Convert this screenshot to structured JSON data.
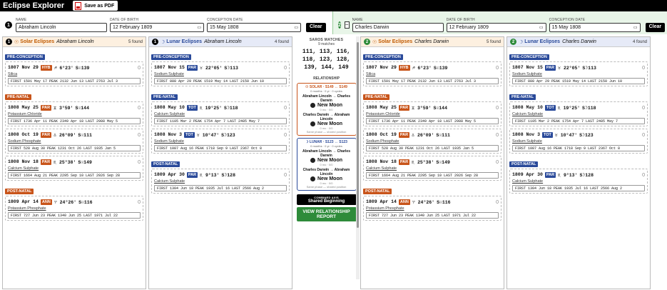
{
  "app": {
    "title": "Eclipse Explorer",
    "save_pdf": "Save as PDF"
  },
  "labels": {
    "name": "NAME",
    "dob": "DATE OF BIRTH",
    "conception": "CONCEPTION DATE",
    "clear": "Clear",
    "found_suffix": "found"
  },
  "persons": [
    {
      "num": "1",
      "name": "Abraham Lincoln",
      "dob": "12 February 1809",
      "conception": "15 May 1808"
    },
    {
      "num": "2",
      "name": "Charles Darwin",
      "dob": "12 February 1809",
      "conception": "15 May 1808"
    }
  ],
  "columns": [
    {
      "num": "1",
      "kind": "Solar Eclipses",
      "who": "Abraham Lincoln",
      "found": "5 found",
      "type": "solar",
      "sections": [
        {
          "label": "PRE-CONCEPTION",
          "color": "blue",
          "items": [
            {
              "date": "1807 Nov 29",
              "badge": "HYB",
              "pos": "♐ 6°23'",
              "saros": "S☉139",
              "chem": "Silica",
              "cycle": "FIRST 1501 May 17  PEAK 2132 Jun 13  LAST 2763 Jul 3"
            }
          ]
        },
        {
          "label": "PRE-NATAL",
          "color": "orange",
          "items": [
            {
              "date": "1808 May 25",
              "badge": "PAR",
              "pos": "♊ 3°59'",
              "saros": "S☉144",
              "chem": "Potassium Chloride",
              "cycle": "FIRST 1736 Apr 11  PEAK 2349 Apr 18  LAST 2988 May 5"
            },
            {
              "date": "1808 Oct 19",
              "badge": "PAR",
              "pos": "♎ 26°09'",
              "saros": "S☉111",
              "chem": "Sodium Phosphate",
              "cycle": "FIRST 528 Aug 30  PEAK 1231 Oct 26  LAST 1935 Jan 5"
            },
            {
              "date": "1808 Nov 18",
              "badge": "PAR",
              "pos": "♏ 25°38'",
              "saros": "S☉149",
              "chem": "Calcium Sulphate",
              "cycle": "FIRST 1664 Aug 21  PEAK 2295 Sep 10  LAST 2926 Sep 28"
            }
          ]
        },
        {
          "label": "POST-NATAL",
          "color": "orange",
          "items": [
            {
              "date": "1809 Apr 14",
              "badge": "ANN",
              "pos": "♈ 24°26'",
              "saros": "S☉116",
              "chem": "Potassium Phosphate",
              "cycle": "FIRST 727 Jun 23  PEAK 1340 Jun 25  LAST 1971 Jul 22"
            }
          ]
        }
      ]
    },
    {
      "num": "1",
      "kind": "Lunar Eclipses",
      "who": "Abraham Lincoln",
      "found": "4 found",
      "type": "lunar",
      "sections": [
        {
          "label": "PRE-CONCEPTION",
          "color": "blue",
          "items": [
            {
              "date": "1807 Nov 15",
              "badge": "PAR",
              "pos": "♉ 22°05'",
              "saros": "S☽113",
              "chem": "Sodium Sulphate",
              "cycle": "FIRST 888 Apr 29  PEAK 1519 May 14  LAST 2150 Jun 10"
            }
          ]
        },
        {
          "label": "PRE-NATAL",
          "color": "blue",
          "items": [
            {
              "date": "1808 May 10",
              "badge": "TOT",
              "pos": "♏ 19°25'",
              "saros": "S☽118",
              "chem": "Calcium Sulphate",
              "cycle": "FIRST 1105 Mar 2  PEAK 1754 Apr 7  LAST 2485 May 7"
            },
            {
              "date": "1808 Nov 3",
              "badge": "TOT",
              "pos": "♉ 10°47'",
              "saros": "S☽123",
              "chem": "Sodium Sulphate",
              "cycle": "FIRST 1087 Aug 16  PEAK 1718 Sep 9  LAST 2367 Oct 8"
            }
          ]
        },
        {
          "label": "POST-NATAL",
          "color": "blue",
          "items": [
            {
              "date": "1809 Apr 30",
              "badge": "PAR",
              "pos": "♏ 9°13'",
              "saros": "S☽128",
              "chem": "Calcium Sulphate",
              "cycle": "FIRST 1304 Jun 18  PEAK 1935 Jul 16  LAST 2566 Aug 2"
            }
          ]
        }
      ]
    },
    {
      "num": "2",
      "kind": "Solar Eclipses",
      "who": "Charles Darwin",
      "found": "5 found",
      "type": "solar",
      "sections": [
        {
          "label": "PRE-CONCEPTION",
          "color": "blue",
          "items": [
            {
              "date": "1807 Nov 29",
              "badge": "HYB",
              "pos": "♐ 6°23'",
              "saros": "S☉139",
              "chem": "Silica",
              "cycle": "FIRST 1501 May 17  PEAK 2132 Jun 13  LAST 2763 Jul 3"
            }
          ]
        },
        {
          "label": "PRE-NATAL",
          "color": "orange",
          "items": [
            {
              "date": "1808 May 25",
              "badge": "PAR",
              "pos": "♊ 3°59'",
              "saros": "S☉144",
              "chem": "Potassium Chloride",
              "cycle": "FIRST 1736 Apr 11  PEAK 2349 Apr 18  LAST 2988 May 5"
            },
            {
              "date": "1808 Oct 19",
              "badge": "PAR",
              "pos": "♎ 26°09'",
              "saros": "S☉111",
              "chem": "Sodium Phosphate",
              "cycle": "FIRST 528 Aug 30  PEAK 1231 Oct 26  LAST 1935 Jan 5"
            },
            {
              "date": "1808 Nov 18",
              "badge": "PAR",
              "pos": "♏ 25°38'",
              "saros": "S☉149",
              "chem": "Calcium Sulphate",
              "cycle": "FIRST 1664 Aug 21  PEAK 2295 Sep 10  LAST 2926 Sep 28"
            }
          ]
        },
        {
          "label": "POST-NATAL",
          "color": "orange",
          "items": [
            {
              "date": "1809 Apr 14",
              "badge": "ANN",
              "pos": "♈ 24°26'",
              "saros": "S☉116",
              "chem": "Potassium Phosphate",
              "cycle": "FIRST 727 Jun 23  PEAK 1340 Jun 25  LAST 1971 Jul 22"
            }
          ]
        }
      ]
    },
    {
      "num": "2",
      "kind": "Lunar Eclipses",
      "who": "Charles Darwin",
      "found": "4 found",
      "type": "lunar",
      "sections": [
        {
          "label": "PRE-CONCEPTION",
          "color": "blue",
          "items": [
            {
              "date": "1807 Nov 15",
              "badge": "PAR",
              "pos": "♉ 22°05'",
              "saros": "S☽113",
              "chem": "Sodium Sulphate",
              "cycle": "FIRST 888 Apr 29  PEAK 1519 May 14  LAST 2150 Jun 10"
            }
          ]
        },
        {
          "label": "PRE-NATAL",
          "color": "blue",
          "items": [
            {
              "date": "1808 May 10",
              "badge": "TOT",
              "pos": "♏ 19°25'",
              "saros": "S☽118",
              "chem": "Calcium Sulphate",
              "cycle": "FIRST 1105 Mar 2  PEAK 1754 Apr 7  LAST 2485 May 7"
            },
            {
              "date": "1808 Nov 3",
              "badge": "TOT",
              "pos": "♉ 10°47'",
              "saros": "S☽123",
              "chem": "Sodium Sulphate",
              "cycle": "FIRST 1087 Aug 16  PEAK 1718 Sep 9  LAST 2367 Oct 8"
            }
          ]
        },
        {
          "label": "POST-NATAL",
          "color": "blue",
          "items": [
            {
              "date": "1809 Apr 30",
              "badge": "PAR",
              "pos": "♏ 9°13'",
              "saros": "S☽128",
              "chem": "Calcium Sulphate",
              "cycle": "FIRST 1304 Jun 18  PEAK 1935 Jul 16  LAST 2566 Aug 2"
            }
          ]
        }
      ]
    }
  ],
  "center": {
    "saros_title": "SAROS MATCHES",
    "matches": "9 matches",
    "numbers_line1": "111, 113, 116,",
    "numbers_line2": "118, 123, 128,",
    "numbers_line3": "139, 144, 149",
    "relationship": "RELATIONSHIP",
    "solar_box": {
      "title": "☉ SOLAR · S149 ↔ S149",
      "meta": "0 months · 0 yr · 0 cycles",
      "pair1": "Abraham Lincoln → Charles Darwin",
      "phase1": "New Moon",
      "small1": "0 mo · 0/0",
      "pair2": "Charles Darwin → Abraham Lincoln",
      "phase2": "New Moon",
      "small2": "0 mo · 0/0",
      "footer": "Same phase — shared position"
    },
    "lunar_box": {
      "title": "☽ LUNAR · S123 ↔ S123",
      "meta": "0 months · 0 yr · 0 cycles",
      "pair1": "Abraham Lincoln → Charles Darwin",
      "phase1": "New Moon",
      "small1": "0 mo · 0/0",
      "pair2": "Charles Darwin → Abraham Lincoln",
      "phase2": "New Moon",
      "small2": "0 mo · 0/0",
      "footer": "Same phase — shared position"
    },
    "combined_label": "COMBINED AXIS",
    "combined_value": "Shared Beginning",
    "view_btn": "VIEW RELATIONSHIP REPORT"
  }
}
